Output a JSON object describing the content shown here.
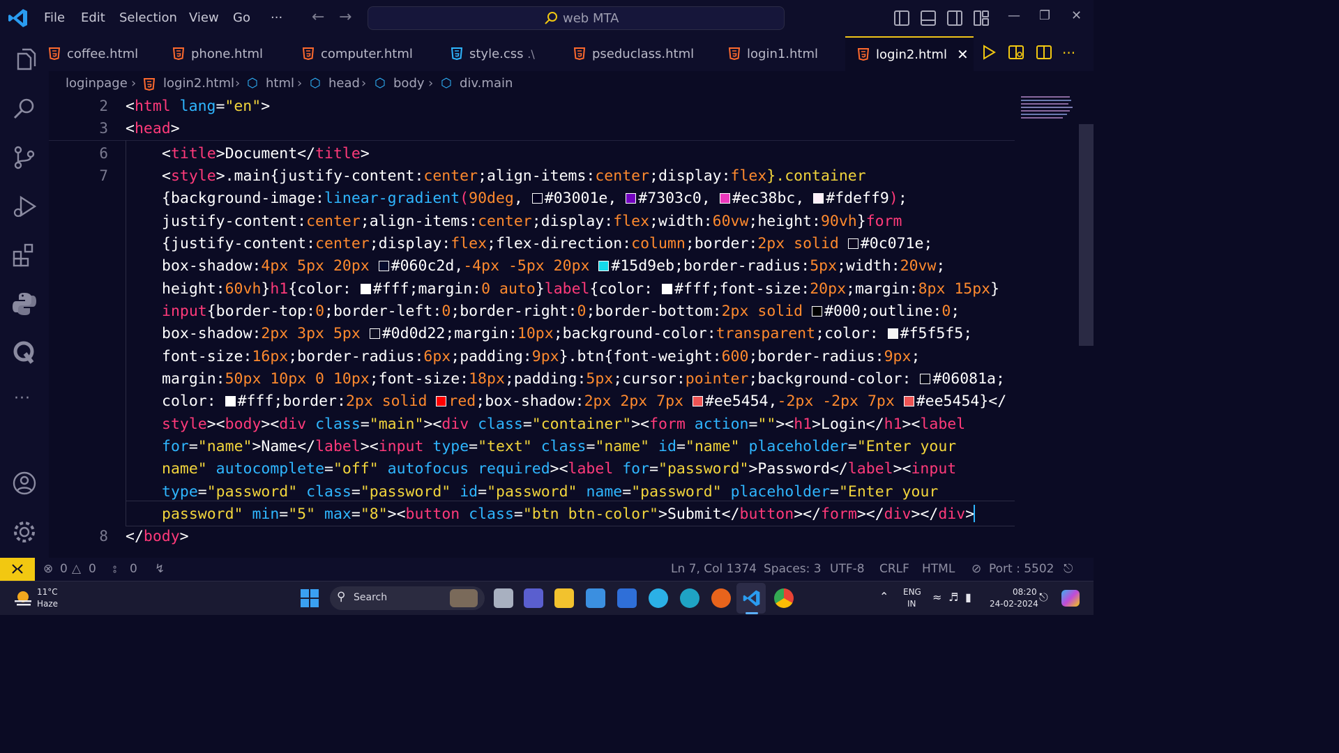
{
  "titlebar": {
    "menu": [
      "File",
      "Edit",
      "Selection",
      "View",
      "Go",
      "···"
    ],
    "search_text": "web MTA"
  },
  "tabs": [
    {
      "label": "coffee.html",
      "icon": "html5-icon"
    },
    {
      "label": "phone.html",
      "icon": "html5-icon"
    },
    {
      "label": "computer.html",
      "icon": "html5-icon"
    },
    {
      "label": "style.css",
      "suffix": ".\\",
      "icon": "css3-icon"
    },
    {
      "label": "pseduclass.html",
      "icon": "html5-icon"
    },
    {
      "label": "login1.html",
      "icon": "html5-icon"
    },
    {
      "label": "login2.html",
      "icon": "html5-icon",
      "active": true
    }
  ],
  "breadcrumb": [
    "loginpage",
    "login2.html",
    "html",
    "head",
    "body",
    "div.main"
  ],
  "line_numbers": [
    "2",
    "3",
    "6",
    "7",
    "8"
  ],
  "code_lines": [
    [
      {
        "t": "<",
        "c": "#ffffff"
      },
      {
        "t": "html",
        "c": "#ff3a7a"
      },
      {
        "t": " lang",
        "c": "#2fb6ff"
      },
      {
        "t": "=",
        "c": "#ffffff"
      },
      {
        "t": "\"en\"",
        "c": "#f2d53c"
      },
      {
        "t": ">",
        "c": "#ffffff"
      }
    ],
    [
      {
        "t": "<",
        "c": "#ffffff"
      },
      {
        "t": "head",
        "c": "#ff3a7a"
      },
      {
        "t": ">",
        "c": "#ffffff"
      }
    ],
    [
      {
        "t": "<",
        "c": "#ffffff"
      },
      {
        "t": "title",
        "c": "#ff3a7a"
      },
      {
        "t": ">Document</",
        "c": "#ffffff"
      },
      {
        "t": "title",
        "c": "#ff3a7a"
      },
      {
        "t": ">",
        "c": "#ffffff"
      }
    ],
    [
      {
        "t": "<",
        "c": "#ffffff"
      },
      {
        "t": "style",
        "c": "#ff3a7a"
      },
      {
        "t": ">.main{justify-content:",
        "c": "#ffffff"
      },
      {
        "t": "center",
        "c": "#ff8a2e"
      },
      {
        "t": ";align-items:",
        "c": "#ffffff"
      },
      {
        "t": "center",
        "c": "#ff8a2e"
      },
      {
        "t": ";display:",
        "c": "#ffffff"
      },
      {
        "t": "flex",
        "c": "#ff8a2e"
      },
      {
        "t": "}.container",
        "c": "#f2d53c"
      }
    ],
    [
      {
        "t": "{background-image:",
        "c": "#ffffff"
      },
      {
        "t": "linear-gradient",
        "c": "#2fb6ff"
      },
      {
        "t": "(",
        "c": "#ff3a7a"
      },
      {
        "t": "90deg",
        "c": "#ff8a2e"
      },
      {
        "t": ", ",
        "c": "#ffffff"
      },
      {
        "sw": "#03001e"
      },
      {
        "t": "#03001e, ",
        "c": "#ffffff"
      },
      {
        "sw": "#7303c0"
      },
      {
        "t": "#7303c0, ",
        "c": "#ffffff"
      },
      {
        "sw": "#ec38bc"
      },
      {
        "t": "#ec38bc, ",
        "c": "#ffffff"
      },
      {
        "sw": "#fdeff9"
      },
      {
        "t": "#fdeff9",
        "c": "#ffffff"
      },
      {
        "t": ")",
        "c": "#ff3a7a"
      },
      {
        "t": ";",
        "c": "#ffffff"
      }
    ],
    [
      {
        "t": "justify-content:",
        "c": "#ffffff"
      },
      {
        "t": "center",
        "c": "#ff8a2e"
      },
      {
        "t": ";align-items:",
        "c": "#ffffff"
      },
      {
        "t": "center",
        "c": "#ff8a2e"
      },
      {
        "t": ";display:",
        "c": "#ffffff"
      },
      {
        "t": "flex",
        "c": "#ff8a2e"
      },
      {
        "t": ";width:",
        "c": "#ffffff"
      },
      {
        "t": "60vw",
        "c": "#ff8a2e"
      },
      {
        "t": ";height:",
        "c": "#ffffff"
      },
      {
        "t": "90vh",
        "c": "#ff8a2e"
      },
      {
        "t": "}",
        "c": "#ffffff"
      },
      {
        "t": "form",
        "c": "#ff3a7a"
      }
    ],
    [
      {
        "t": "{justify-content:",
        "c": "#ffffff"
      },
      {
        "t": "center",
        "c": "#ff8a2e"
      },
      {
        "t": ";display:",
        "c": "#ffffff"
      },
      {
        "t": "flex",
        "c": "#ff8a2e"
      },
      {
        "t": ";flex-direction:",
        "c": "#ffffff"
      },
      {
        "t": "column",
        "c": "#ff8a2e"
      },
      {
        "t": ";border:",
        "c": "#ffffff"
      },
      {
        "t": "2px solid ",
        "c": "#ff8a2e"
      },
      {
        "sw": "#0c071e"
      },
      {
        "t": "#0c071e;",
        "c": "#ffffff"
      }
    ],
    [
      {
        "t": "box-shadow:",
        "c": "#ffffff"
      },
      {
        "t": "4px 5px 20px ",
        "c": "#ff8a2e"
      },
      {
        "sw": "#060c2d"
      },
      {
        "t": "#060c2d,",
        "c": "#ffffff"
      },
      {
        "t": "-4px -5px 20px ",
        "c": "#ff8a2e"
      },
      {
        "sw": "#15d9eb"
      },
      {
        "t": "#15d9eb;border-radius:",
        "c": "#ffffff"
      },
      {
        "t": "5px",
        "c": "#ff8a2e"
      },
      {
        "t": ";width:",
        "c": "#ffffff"
      },
      {
        "t": "20vw",
        "c": "#ff8a2e"
      },
      {
        "t": ";",
        "c": "#ffffff"
      }
    ],
    [
      {
        "t": "height:",
        "c": "#ffffff"
      },
      {
        "t": "60vh",
        "c": "#ff8a2e"
      },
      {
        "t": "}",
        "c": "#ffffff"
      },
      {
        "t": "h1",
        "c": "#ff3a7a"
      },
      {
        "t": "{color: ",
        "c": "#ffffff"
      },
      {
        "sw": "#ffffff"
      },
      {
        "t": "#fff;margin:",
        "c": "#ffffff"
      },
      {
        "t": "0 auto",
        "c": "#ff8a2e"
      },
      {
        "t": "}",
        "c": "#ffffff"
      },
      {
        "t": "label",
        "c": "#ff3a7a"
      },
      {
        "t": "{color: ",
        "c": "#ffffff"
      },
      {
        "sw": "#ffffff"
      },
      {
        "t": "#fff;font-size:",
        "c": "#ffffff"
      },
      {
        "t": "20px",
        "c": "#ff8a2e"
      },
      {
        "t": ";margin:",
        "c": "#ffffff"
      },
      {
        "t": "8px 15px",
        "c": "#ff8a2e"
      },
      {
        "t": "}",
        "c": "#ffffff"
      }
    ],
    [
      {
        "t": "input",
        "c": "#ff3a7a"
      },
      {
        "t": "{border-top:",
        "c": "#ffffff"
      },
      {
        "t": "0",
        "c": "#ff8a2e"
      },
      {
        "t": ";border-left:",
        "c": "#ffffff"
      },
      {
        "t": "0",
        "c": "#ff8a2e"
      },
      {
        "t": ";border-right:",
        "c": "#ffffff"
      },
      {
        "t": "0",
        "c": "#ff8a2e"
      },
      {
        "t": ";border-bottom:",
        "c": "#ffffff"
      },
      {
        "t": "2px solid ",
        "c": "#ff8a2e"
      },
      {
        "sw": "#000000"
      },
      {
        "t": "#000;outline:",
        "c": "#ffffff"
      },
      {
        "t": "0",
        "c": "#ff8a2e"
      },
      {
        "t": ";",
        "c": "#ffffff"
      }
    ],
    [
      {
        "t": "box-shadow:",
        "c": "#ffffff"
      },
      {
        "t": "2px 3px 5px ",
        "c": "#ff8a2e"
      },
      {
        "sw": "#0d0d22"
      },
      {
        "t": "#0d0d22;margin:",
        "c": "#ffffff"
      },
      {
        "t": "10px",
        "c": "#ff8a2e"
      },
      {
        "t": ";background-color:",
        "c": "#ffffff"
      },
      {
        "t": "transparent",
        "c": "#ff8a2e"
      },
      {
        "t": ";color: ",
        "c": "#ffffff"
      },
      {
        "sw": "#f5f5f5"
      },
      {
        "t": "#f5f5f5;",
        "c": "#ffffff"
      }
    ],
    [
      {
        "t": "font-size:",
        "c": "#ffffff"
      },
      {
        "t": "16px",
        "c": "#ff8a2e"
      },
      {
        "t": ";border-radius:",
        "c": "#ffffff"
      },
      {
        "t": "6px",
        "c": "#ff8a2e"
      },
      {
        "t": ";padding:",
        "c": "#ffffff"
      },
      {
        "t": "9px",
        "c": "#ff8a2e"
      },
      {
        "t": "}.btn{font-weight:",
        "c": "#ffffff"
      },
      {
        "t": "600",
        "c": "#ff8a2e"
      },
      {
        "t": ";border-radius:",
        "c": "#ffffff"
      },
      {
        "t": "9px",
        "c": "#ff8a2e"
      },
      {
        "t": ";",
        "c": "#ffffff"
      }
    ],
    [
      {
        "t": "margin:",
        "c": "#ffffff"
      },
      {
        "t": "50px 10px 0 10px",
        "c": "#ff8a2e"
      },
      {
        "t": ";font-size:",
        "c": "#ffffff"
      },
      {
        "t": "18px",
        "c": "#ff8a2e"
      },
      {
        "t": ";padding:",
        "c": "#ffffff"
      },
      {
        "t": "5px",
        "c": "#ff8a2e"
      },
      {
        "t": ";cursor:",
        "c": "#ffffff"
      },
      {
        "t": "pointer",
        "c": "#ff8a2e"
      },
      {
        "t": ";background-color: ",
        "c": "#ffffff"
      },
      {
        "sw": "#06081a"
      },
      {
        "t": "#06081a;",
        "c": "#ffffff"
      }
    ],
    [
      {
        "t": "color: ",
        "c": "#ffffff"
      },
      {
        "sw": "#ffffff"
      },
      {
        "t": "#fff;border:",
        "c": "#ffffff"
      },
      {
        "t": "2px solid ",
        "c": "#ff8a2e"
      },
      {
        "sw": "#ff0000"
      },
      {
        "t": "red",
        "c": "#ff8a2e"
      },
      {
        "t": ";box-shadow:",
        "c": "#ffffff"
      },
      {
        "t": "2px 2px 7px ",
        "c": "#ff8a2e"
      },
      {
        "sw": "#ee5454"
      },
      {
        "t": "#ee5454,",
        "c": "#ffffff"
      },
      {
        "t": "-2px -2px 7px ",
        "c": "#ff8a2e"
      },
      {
        "sw": "#ee5454"
      },
      {
        "t": "#ee5454}</",
        "c": "#ffffff"
      }
    ],
    [
      {
        "t": "style",
        "c": "#ff3a7a"
      },
      {
        "t": "><",
        "c": "#ffffff"
      },
      {
        "t": "body",
        "c": "#ff3a7a"
      },
      {
        "t": "><",
        "c": "#ffffff"
      },
      {
        "t": "div",
        "c": "#ff3a7a"
      },
      {
        "t": " class",
        "c": "#2fb6ff"
      },
      {
        "t": "=",
        "c": "#ffffff"
      },
      {
        "t": "\"main\"",
        "c": "#f2d53c"
      },
      {
        "t": "><",
        "c": "#ffffff"
      },
      {
        "t": "div",
        "c": "#ff3a7a"
      },
      {
        "t": " class",
        "c": "#2fb6ff"
      },
      {
        "t": "=",
        "c": "#ffffff"
      },
      {
        "t": "\"container\"",
        "c": "#f2d53c"
      },
      {
        "t": "><",
        "c": "#ffffff"
      },
      {
        "t": "form",
        "c": "#ff3a7a"
      },
      {
        "t": " action",
        "c": "#2fb6ff"
      },
      {
        "t": "=",
        "c": "#ffffff"
      },
      {
        "t": "\"\"",
        "c": "#f2d53c"
      },
      {
        "t": "><",
        "c": "#ffffff"
      },
      {
        "t": "h1",
        "c": "#ff3a7a"
      },
      {
        "t": ">Login</",
        "c": "#ffffff"
      },
      {
        "t": "h1",
        "c": "#ff3a7a"
      },
      {
        "t": "><",
        "c": "#ffffff"
      },
      {
        "t": "label",
        "c": "#ff3a7a"
      }
    ],
    [
      {
        "t": "for",
        "c": "#2fb6ff"
      },
      {
        "t": "=",
        "c": "#ffffff"
      },
      {
        "t": "\"name\"",
        "c": "#f2d53c"
      },
      {
        "t": ">Name</",
        "c": "#ffffff"
      },
      {
        "t": "label",
        "c": "#ff3a7a"
      },
      {
        "t": "><",
        "c": "#ffffff"
      },
      {
        "t": "input",
        "c": "#ff3a7a"
      },
      {
        "t": " type",
        "c": "#2fb6ff"
      },
      {
        "t": "=",
        "c": "#ffffff"
      },
      {
        "t": "\"text\"",
        "c": "#f2d53c"
      },
      {
        "t": " class",
        "c": "#2fb6ff"
      },
      {
        "t": "=",
        "c": "#ffffff"
      },
      {
        "t": "\"name\"",
        "c": "#f2d53c"
      },
      {
        "t": " id",
        "c": "#2fb6ff"
      },
      {
        "t": "=",
        "c": "#ffffff"
      },
      {
        "t": "\"name\"",
        "c": "#f2d53c"
      },
      {
        "t": " placeholder",
        "c": "#2fb6ff"
      },
      {
        "t": "=",
        "c": "#ffffff"
      },
      {
        "t": "\"Enter your",
        "c": "#f2d53c"
      }
    ],
    [
      {
        "t": "name\"",
        "c": "#f2d53c"
      },
      {
        "t": " autocomplete",
        "c": "#2fb6ff"
      },
      {
        "t": "=",
        "c": "#ffffff"
      },
      {
        "t": "\"off\"",
        "c": "#f2d53c"
      },
      {
        "t": " autofocus required",
        "c": "#2fb6ff"
      },
      {
        "t": "><",
        "c": "#ffffff"
      },
      {
        "t": "label",
        "c": "#ff3a7a"
      },
      {
        "t": " for",
        "c": "#2fb6ff"
      },
      {
        "t": "=",
        "c": "#ffffff"
      },
      {
        "t": "\"password\"",
        "c": "#f2d53c"
      },
      {
        "t": ">Password</",
        "c": "#ffffff"
      },
      {
        "t": "label",
        "c": "#ff3a7a"
      },
      {
        "t": "><",
        "c": "#ffffff"
      },
      {
        "t": "input",
        "c": "#ff3a7a"
      }
    ],
    [
      {
        "t": "type",
        "c": "#2fb6ff"
      },
      {
        "t": "=",
        "c": "#ffffff"
      },
      {
        "t": "\"password\"",
        "c": "#f2d53c"
      },
      {
        "t": " class",
        "c": "#2fb6ff"
      },
      {
        "t": "=",
        "c": "#ffffff"
      },
      {
        "t": "\"password\"",
        "c": "#f2d53c"
      },
      {
        "t": " id",
        "c": "#2fb6ff"
      },
      {
        "t": "=",
        "c": "#ffffff"
      },
      {
        "t": "\"password\"",
        "c": "#f2d53c"
      },
      {
        "t": " name",
        "c": "#2fb6ff"
      },
      {
        "t": "=",
        "c": "#ffffff"
      },
      {
        "t": "\"password\"",
        "c": "#f2d53c"
      },
      {
        "t": " placeholder",
        "c": "#2fb6ff"
      },
      {
        "t": "=",
        "c": "#ffffff"
      },
      {
        "t": "\"Enter your",
        "c": "#f2d53c"
      }
    ],
    [
      {
        "t": "password\"",
        "c": "#f2d53c"
      },
      {
        "t": " min",
        "c": "#2fb6ff"
      },
      {
        "t": "=",
        "c": "#ffffff"
      },
      {
        "t": "\"5\"",
        "c": "#f2d53c"
      },
      {
        "t": " max",
        "c": "#2fb6ff"
      },
      {
        "t": "=",
        "c": "#ffffff"
      },
      {
        "t": "\"8\"",
        "c": "#f2d53c"
      },
      {
        "t": "><",
        "c": "#ffffff"
      },
      {
        "t": "button",
        "c": "#ff3a7a"
      },
      {
        "t": " class",
        "c": "#2fb6ff"
      },
      {
        "t": "=",
        "c": "#ffffff"
      },
      {
        "t": "\"btn btn-color\"",
        "c": "#f2d53c"
      },
      {
        "t": ">Submit</",
        "c": "#ffffff"
      },
      {
        "t": "button",
        "c": "#ff3a7a"
      },
      {
        "t": "></",
        "c": "#ffffff"
      },
      {
        "t": "form",
        "c": "#ff3a7a"
      },
      {
        "t": "></",
        "c": "#ffffff"
      },
      {
        "t": "div",
        "c": "#ff3a7a"
      },
      {
        "t": "></",
        "c": "#ffffff"
      },
      {
        "t": "div",
        "c": "#ff3a7a"
      },
      {
        "t": ">",
        "c": "#ffffff"
      }
    ],
    [
      {
        "t": "</",
        "c": "#ffffff"
      },
      {
        "t": "body",
        "c": "#ff3a7a"
      },
      {
        "t": ">",
        "c": "#ffffff"
      }
    ]
  ],
  "statusbar": {
    "errors": "0",
    "warnings": "0",
    "ports": "0",
    "cursor": "Ln 7, Col 1374",
    "spaces": "Spaces: 3",
    "encoding": "UTF-8",
    "eol": "CRLF",
    "language": "HTML",
    "port": "Port : 5502"
  },
  "taskbar": {
    "weather_temp": "11°C",
    "weather_desc": "Haze",
    "search": "Search",
    "lang1": "ENG",
    "lang2": "IN",
    "time": "08:20",
    "date": "24-02-2024"
  },
  "colors": {
    "background": "#0b0b24",
    "accent": "#f2c811",
    "tag": "#ff3a7a",
    "attribute": "#2fb6ff",
    "string": "#f2d53c",
    "value": "#ff8a2e"
  }
}
